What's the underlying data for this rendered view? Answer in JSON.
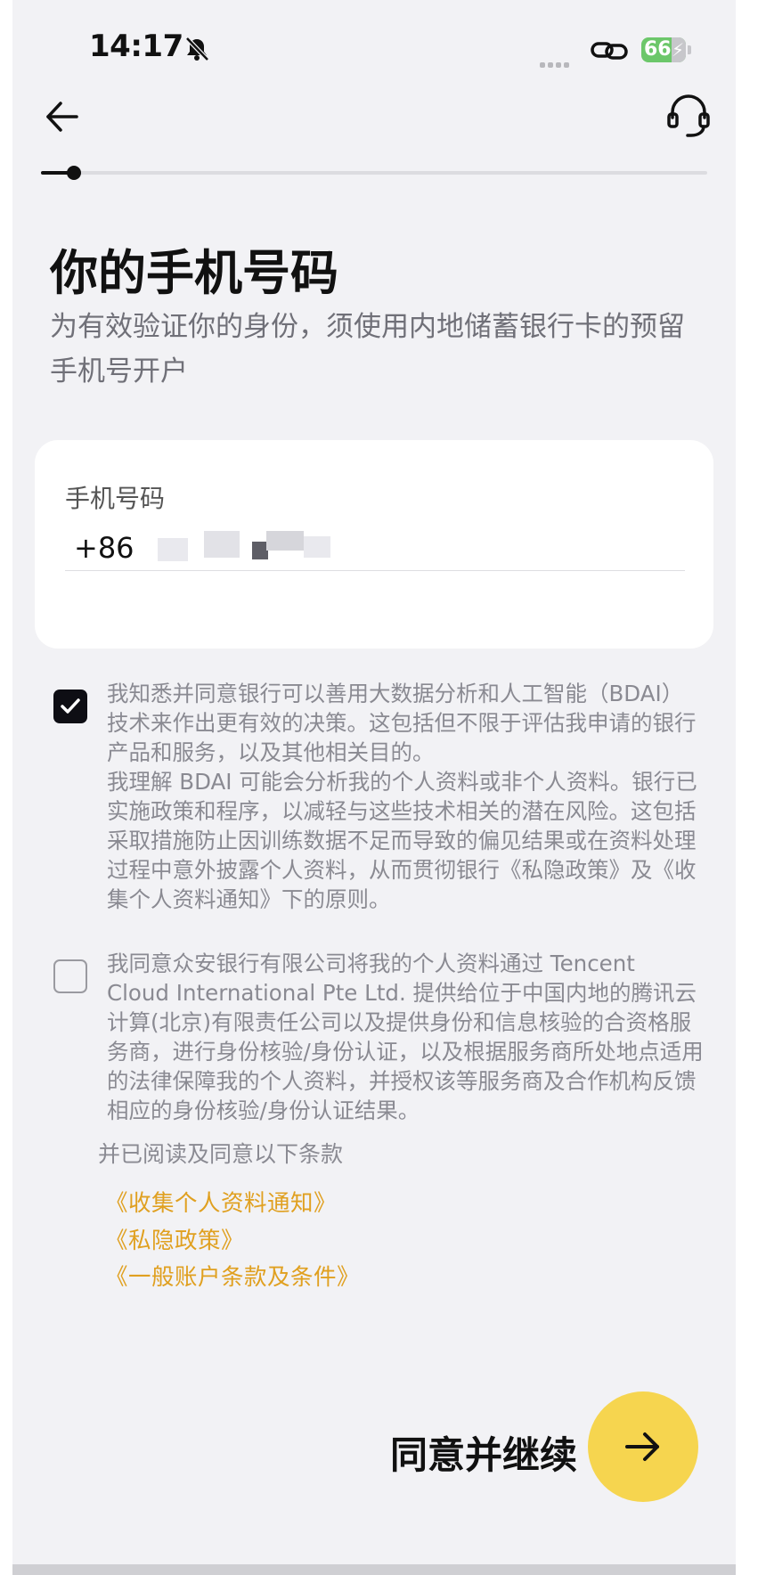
{
  "status_bar": {
    "time": "14:17",
    "battery": "66",
    "icons": [
      "bell-off-icon",
      "signal-icon",
      "link-icon",
      "battery-icon",
      "charging-bolt-icon"
    ]
  },
  "nav": {
    "back_icon": "arrow-left-icon",
    "support_icon": "headset-icon",
    "progress_fraction": 0.05
  },
  "page": {
    "title": "你的手机号码",
    "subtitle": "为有效验证你的身份，须使用内地储蓄银行卡的预留手机号开户"
  },
  "phone_field": {
    "label": "手机号码",
    "country_code": "+86",
    "value": ""
  },
  "consents": [
    {
      "checked": true,
      "paragraphs": [
        "我知悉并同意银行可以善用大数据分析和人工智能（BDAI）技术来作出更有效的决策。这包括但不限于评估我申请的银行产品和服务，以及其他相关目的。",
        "我理解 BDAI 可能会分析我的个人资料或非个人资料。银行已实施政策和程序，以减轻与这些技术相关的潜在风险。这包括采取措施防止因训练数据不足而导致的偏见结果或在资料处理过程中意外披露个人资料，从而贯彻银行《私隐政策》及《收集个人资料通知》下的原则。"
      ]
    },
    {
      "checked": false,
      "paragraphs": [
        "我同意众安银行有限公司将我的个人资料通过 Tencent Cloud International Pte Ltd. 提供给位于中国内地的腾讯云计算(北京)有限责任公司以及提供身份和信息核验的合资格服务商，进行身份核验/身份认证，以及根据服务商所处地点适用的法律保障我的个人资料，并授权该等服务商及合作机构反馈相应的身份核验/身份认证结果。"
      ]
    }
  ],
  "terms": {
    "intro": "并已阅读及同意以下条款",
    "links": [
      "《收集个人资料通知》",
      "《私隐政策》",
      "《一般账户条款及条件》"
    ],
    "link_color": "#e0a020"
  },
  "footer": {
    "continue_label": "同意并继续",
    "continue_icon": "arrow-right-icon",
    "button_color": "#f6d54f"
  }
}
